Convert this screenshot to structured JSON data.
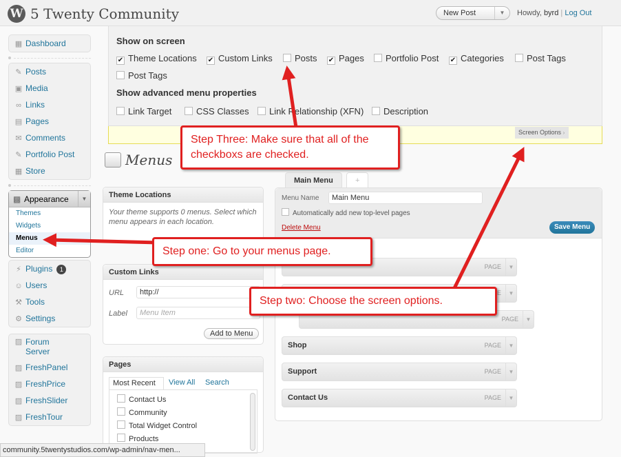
{
  "header": {
    "site_title": "5 Twenty Community",
    "favorite_action": "New Post",
    "howdy": "Howdy,",
    "user": "byrd",
    "logout": "Log Out"
  },
  "sidebar": {
    "dashboard": "Dashboard",
    "posts": "Posts",
    "media": "Media",
    "links": "Links",
    "pages": "Pages",
    "comments": "Comments",
    "portfolio_post": "Portfolio Post",
    "store": "Store",
    "appearance": "Appearance",
    "themes": "Themes",
    "widgets": "Widgets",
    "menus": "Menus",
    "editor": "Editor",
    "plugins": "Plugins",
    "plugins_count": "1",
    "users": "Users",
    "tools": "Tools",
    "settings": "Settings",
    "forum_server": "Forum Server",
    "freshpanel": "FreshPanel",
    "freshprice": "FreshPrice",
    "freshslider": "FreshSlider",
    "freshtour": "FreshTour"
  },
  "screen_options": {
    "show_on_screen": "Show on screen",
    "items": [
      {
        "label": "Theme Locations",
        "checked": true
      },
      {
        "label": "Custom Links",
        "checked": true
      },
      {
        "label": "Posts",
        "checked": false
      },
      {
        "label": "Pages",
        "checked": true
      },
      {
        "label": "Portfolio Post",
        "checked": false
      },
      {
        "label": "Categories",
        "checked": true
      },
      {
        "label": "Post Tags",
        "checked": false
      },
      {
        "label": "Post Tags",
        "checked": false
      }
    ],
    "advanced_title": "Show advanced menu properties",
    "advanced": [
      {
        "label": "Link Target",
        "checked": false
      },
      {
        "label": "CSS Classes",
        "checked": false
      },
      {
        "label": "Link Relationship (XFN)",
        "checked": false
      },
      {
        "label": "Description",
        "checked": false
      }
    ],
    "tab_label": "Screen Options"
  },
  "page_title": "Menus",
  "theme_locations": {
    "title": "Theme Locations",
    "text": "Your theme supports 0 menus. Select which menu appears in each location."
  },
  "custom_links": {
    "title": "Custom Links",
    "url_label": "URL",
    "url_value": "http://",
    "label_label": "Label",
    "label_placeholder": "Menu Item",
    "add_button": "Add to Menu"
  },
  "pages_box": {
    "title": "Pages",
    "tabs": [
      "Most Recent",
      "View All",
      "Search"
    ],
    "items": [
      "Contact Us",
      "Community",
      "Total Widget Control",
      "Products"
    ]
  },
  "menu_editor": {
    "tab_label": "Main Menu",
    "add_tab": "+",
    "menu_name_label": "Menu Name",
    "menu_name_value": "Main Menu",
    "auto_add_label": "Automatically add new top-level pages",
    "delete_label": "Delete Menu",
    "save_label": "Save Menu",
    "type_label": "PAGE",
    "items": [
      "",
      "",
      "",
      "Shop",
      "Support",
      "Contact Us"
    ]
  },
  "callouts": {
    "step_one": "Step one: Go to your menus page.",
    "step_two": "Step two: Choose the screen options.",
    "step_three": "Step Three: Make sure that all of the checkboxs are checked."
  },
  "status_bar": "community.5twentystudios.com/wp-admin/nav-men..."
}
